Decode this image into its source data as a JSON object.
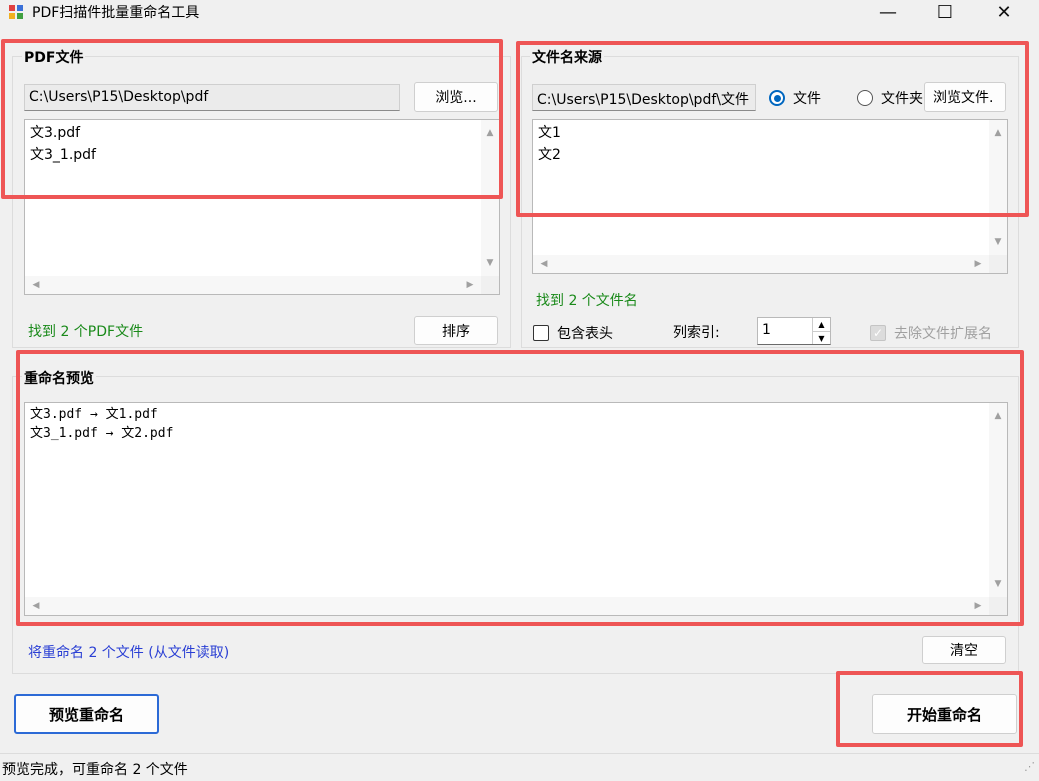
{
  "window": {
    "title": "PDF扫描件批量重命名工具",
    "minimize": "—",
    "maximize": "☐",
    "close": "✕"
  },
  "pdf_group": {
    "title": "PDF文件",
    "path": "C:\\Users\\P15\\Desktop\\pdf",
    "browse_label": "浏览...",
    "files": [
      "文3.pdf",
      "文3_1.pdf"
    ],
    "status": "找到 2 个PDF文件",
    "sort_label": "排序"
  },
  "name_group": {
    "title": "文件名来源",
    "path": "C:\\Users\\P15\\Desktop\\pdf\\文件",
    "radio_file": "文件",
    "radio_folder": "文件夹",
    "selected": "文件",
    "browse_label": "浏览文件.",
    "names": [
      "文1",
      "文2"
    ],
    "status": "找到 2 个文件名",
    "include_header_label": "包含表头",
    "include_header_checked": false,
    "col_index_label": "列索引:",
    "col_index_value": "1",
    "remove_ext_label": "去除文件扩展名",
    "remove_ext_checked": true
  },
  "preview_group": {
    "title": "重命名预览",
    "lines": [
      "文3.pdf → 文1.pdf",
      "文3_1.pdf → 文2.pdf"
    ],
    "summary": "将重命名 2 个文件 (从文件读取)",
    "clear_label": "清空"
  },
  "actions": {
    "preview_label": "预览重命名",
    "start_label": "开始重命名"
  },
  "status_bar": {
    "text": "预览完成，可重命名 2 个文件"
  },
  "colors": {
    "highlight": "#ee5555",
    "status_green": "#1a8a1a",
    "status_blue": "#2a3fd4",
    "radio_accent": "#0067c0"
  }
}
